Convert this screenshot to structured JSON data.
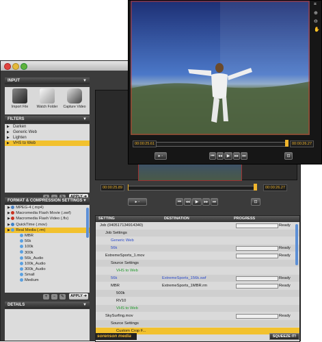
{
  "input": {
    "header": "INPUT",
    "buttons": [
      {
        "label": "Import File",
        "icon": "film-icon"
      },
      {
        "label": "Watch Folder",
        "icon": "folder-icon"
      },
      {
        "label": "Capture Video",
        "icon": "camera-icon"
      }
    ]
  },
  "filters": {
    "header": "FILTERS",
    "items": [
      "Darken",
      "Generic Web",
      "Lighten",
      "VHS to Web"
    ],
    "selected": 3,
    "apply": "APPLY ➔"
  },
  "formats": {
    "header": "FORMAT & COMPRESSION SETTINGS",
    "items": [
      {
        "label": "MPEG-4 (.mp4)",
        "color": "#4a7fc0",
        "level": 0
      },
      {
        "label": "Macromedia Flash Movie (.swf)",
        "color": "#c8311f",
        "level": 0
      },
      {
        "label": "Macromedia Flash Video (.flv)",
        "color": "#c8311f",
        "level": 0
      },
      {
        "label": "QuickTime (.mov)",
        "color": "#3d82c8",
        "level": 0
      },
      {
        "label": "Real Media (.rm)",
        "color": "#5aa0e0",
        "level": 0
      },
      {
        "label": "MBR",
        "color": "#5aa0e0",
        "level": 1
      },
      {
        "label": "56k",
        "color": "#5aa0e0",
        "level": 1
      },
      {
        "label": "100k",
        "color": "#5aa0e0",
        "level": 1
      },
      {
        "label": "300k",
        "color": "#5aa0e0",
        "level": 1
      },
      {
        "label": "56k_Audio",
        "color": "#5aa0e0",
        "level": 1
      },
      {
        "label": "100k_Audio",
        "color": "#5aa0e0",
        "level": 1
      },
      {
        "label": "300k_Audio",
        "color": "#5aa0e0",
        "level": 1
      },
      {
        "label": "Small",
        "color": "#5aa0e0",
        "level": 1
      },
      {
        "label": "Medium",
        "color": "#5aa0e0",
        "level": 1
      }
    ],
    "selected": 4,
    "apply": "APPLY ➔"
  },
  "details": {
    "header": "DETAILS"
  },
  "player": {
    "timecode_in": "00:00:25.89",
    "timecode_out": "00:00:26.27"
  },
  "overlay": {
    "timecode_in": "00:00:25.61",
    "timecode_out": "00:00:26.27"
  },
  "joblist": {
    "headers": [
      "SETTING",
      "DESTINATION",
      "PROGRESS"
    ],
    "rows": [
      {
        "indent": 0,
        "text": "Job (040517134914340)",
        "dest": "",
        "ready": "Ready",
        "bar": true,
        "link": false
      },
      {
        "indent": 1,
        "text": "Job Settings",
        "dest": "",
        "ready": "",
        "bar": false,
        "link": false
      },
      {
        "indent": 2,
        "text": "Generic Web",
        "dest": "",
        "ready": "",
        "bar": false,
        "link": true
      },
      {
        "indent": 2,
        "text": "56k",
        "dest": "",
        "ready": "Ready",
        "bar": true,
        "link": true
      },
      {
        "indent": 1,
        "text": "ExtremeSports_1.mov",
        "dest": "",
        "ready": "Ready",
        "bar": true,
        "link": false
      },
      {
        "indent": 2,
        "text": "Source Settings",
        "dest": "",
        "ready": "",
        "bar": false,
        "link": false
      },
      {
        "indent": 3,
        "text": "VHS to Web",
        "dest": "",
        "ready": "",
        "bar": false,
        "link": true
      },
      {
        "indent": 2,
        "text": "56k",
        "dest": "ExtremeSports_156k.swf",
        "ready": "Ready",
        "bar": true,
        "link": true
      },
      {
        "indent": 2,
        "text": "MBR",
        "dest": "ExtremeSports_1MBR.rm",
        "ready": "Ready",
        "bar": true,
        "link": false
      },
      {
        "indent": 3,
        "text": "500k",
        "dest": "",
        "ready": "",
        "bar": false,
        "link": false
      },
      {
        "indent": 3,
        "text": "RV10",
        "dest": "",
        "ready": "",
        "bar": false,
        "link": false
      },
      {
        "indent": 3,
        "text": "VHS to Web",
        "dest": "",
        "ready": "",
        "bar": false,
        "link": true
      },
      {
        "indent": 1,
        "text": "SkySurfing.mov",
        "dest": "",
        "ready": "Ready",
        "bar": true,
        "link": false
      },
      {
        "indent": 2,
        "text": "Source Settings",
        "dest": "",
        "ready": "",
        "bar": false,
        "link": false
      },
      {
        "indent": 3,
        "text": "Custom Crop F...",
        "dest": "",
        "ready": "",
        "bar": false,
        "link": false,
        "sel": true
      }
    ]
  },
  "footer": {
    "logo": "sorenson media",
    "squeeze": "SQUEEZE IT!"
  },
  "colors": {
    "accent": "#f2c12e",
    "panel": "#dcdcdc",
    "dark": "#3b3b3b",
    "link": "#2a49c8",
    "green": "#1f9a2a"
  }
}
